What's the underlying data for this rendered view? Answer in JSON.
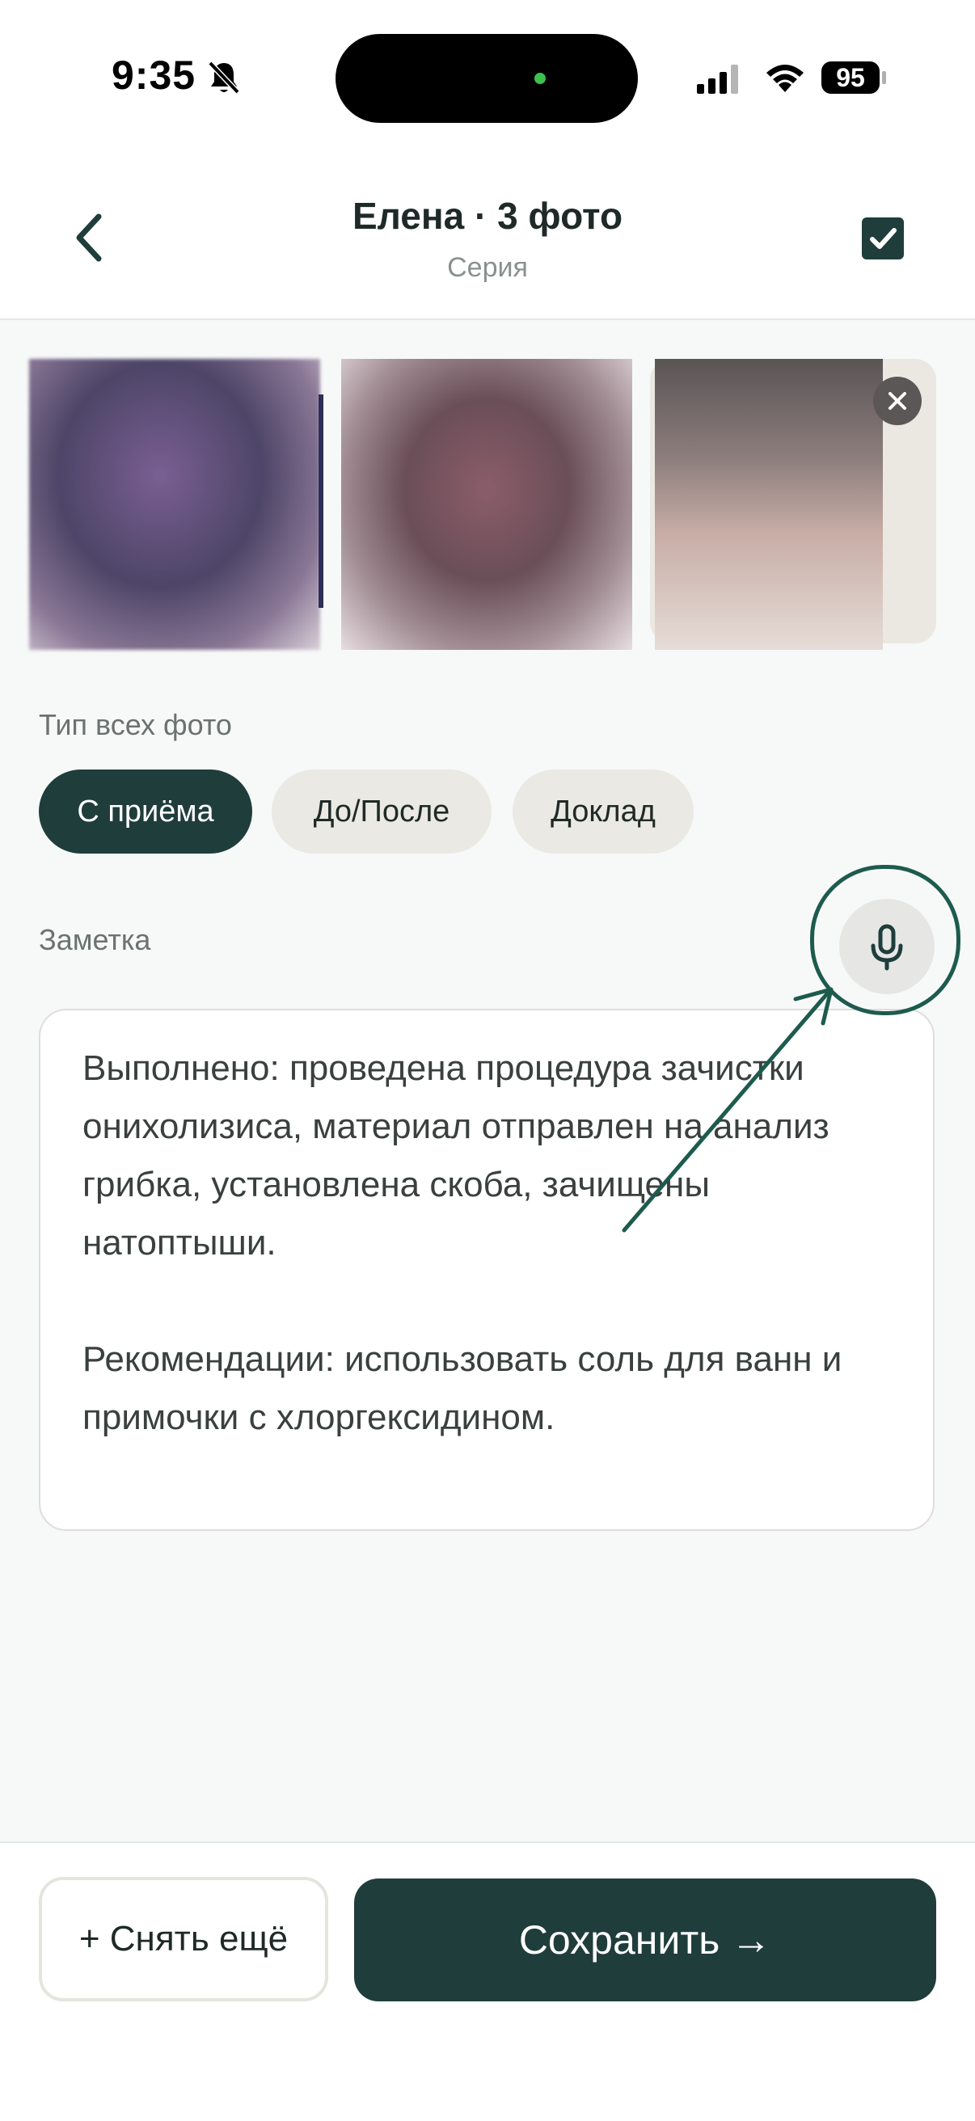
{
  "status_bar": {
    "time": "9:35",
    "battery": "95"
  },
  "header": {
    "title": "Елена · 3 фото",
    "subtitle": "Серия"
  },
  "photo_type": {
    "label": "Тип всех фото",
    "options": [
      "С приёма",
      "До/После",
      "Доклад"
    ],
    "selected": "С приёма"
  },
  "note": {
    "label": "Заметка",
    "text": "Выполнено: проведена процедура зачистки онихолизиса, материал отправлен на анализ грибка, установлена скоба, зачищены натоптыши.\n\nРекомендации: использовать соль для ванн и примочки с хлоргексидином."
  },
  "actions": {
    "shoot_more": "+ Снять ещё",
    "save": "Сохранить →"
  },
  "colors": {
    "accent": "#1f3d3b",
    "annotation": "#1d5b4d",
    "chip_inactive": "#ebe9e3"
  }
}
